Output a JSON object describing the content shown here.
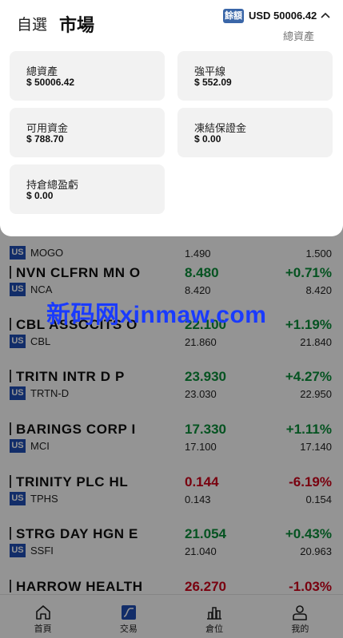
{
  "stocks": [
    {
      "name": "",
      "flag": "US",
      "code": "MOGO",
      "price": "",
      "prev": "1.490",
      "chg": "",
      "ref": "1.500",
      "dir": "up"
    },
    {
      "name": "NVN CLFRN MN O",
      "flag": "US",
      "code": "NCA",
      "price": "8.480",
      "prev": "8.420",
      "chg": "+0.71%",
      "ref": "8.420",
      "dir": "up"
    },
    {
      "name": "CBL ASSOCITS O",
      "flag": "US",
      "code": "CBL",
      "price": "22.100",
      "prev": "21.860",
      "chg": "+1.19%",
      "ref": "21.840",
      "dir": "up"
    },
    {
      "name": "TRITN INTR D P",
      "flag": "US",
      "code": "TRTN-D",
      "price": "23.930",
      "prev": "23.030",
      "chg": "+4.27%",
      "ref": "22.950",
      "dir": "up"
    },
    {
      "name": "BARINGS CORP I",
      "flag": "US",
      "code": "MCI",
      "price": "17.330",
      "prev": "17.100",
      "chg": "+1.11%",
      "ref": "17.140",
      "dir": "up"
    },
    {
      "name": "TRINITY PLC HL",
      "flag": "US",
      "code": "TPHS",
      "price": "0.144",
      "prev": "0.143",
      "chg": "-6.19%",
      "ref": "0.154",
      "dir": "down"
    },
    {
      "name": "STRG DAY HGN E",
      "flag": "US",
      "code": "SSFI",
      "price": "21.054",
      "prev": "21.040",
      "chg": "+0.43%",
      "ref": "20.963",
      "dir": "up"
    },
    {
      "name": "HARROW HEALTH",
      "flag": "",
      "code": "",
      "price": "26.270",
      "prev": "",
      "chg": "-1.03%",
      "ref": "",
      "dir": "down"
    }
  ],
  "watermark": "新码网xinmaw.com",
  "nav": {
    "home": "首頁",
    "trade": "交易",
    "position": "倉位",
    "mine": "我的",
    "active_color": "#1f4fb6"
  },
  "header": {
    "tab_watchlist": "自選",
    "tab_market": "市場",
    "balance_badge": "餘額",
    "balance_value": "USD 50006.42",
    "total_assets_label": "總資產"
  },
  "summary": {
    "total_assets": {
      "label": "總資產",
      "value": "$ 50006.42"
    },
    "liquidation_line": {
      "label": "強平線",
      "value": "$ 552.09"
    },
    "available_funds": {
      "label": "可用資金",
      "value": "$ 788.70"
    },
    "frozen_margin": {
      "label": "凍結保證金",
      "value": "$ 0.00"
    },
    "position_pnl": {
      "label": "持倉總盈虧",
      "value": "$ 0.00"
    }
  },
  "colors": {
    "up": "#0a8f3a",
    "down": "#d0021b",
    "flag_bg": "#1f4fb6"
  }
}
